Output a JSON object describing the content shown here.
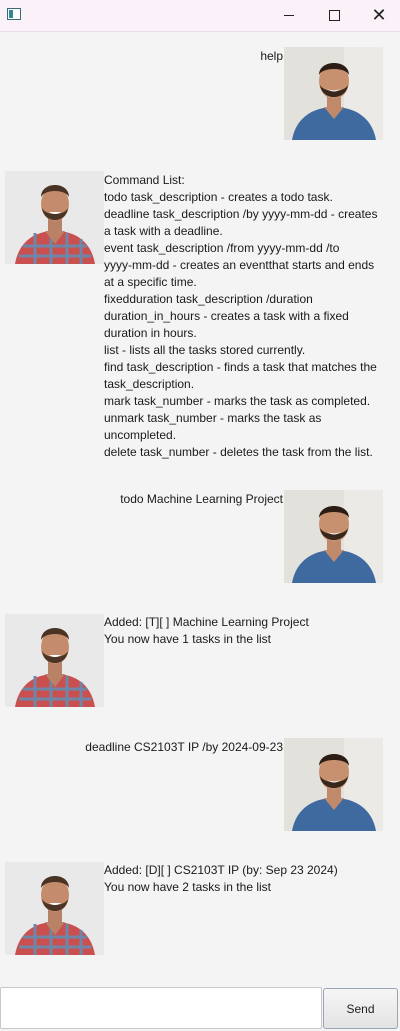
{
  "window": {
    "title": "",
    "minimize": "",
    "maximize": "",
    "close": "✕"
  },
  "chat": {
    "messages": [
      {
        "sender": "user",
        "avatar": "user-avatar",
        "lines": [
          "help"
        ]
      },
      {
        "sender": "bot",
        "avatar": "bot-avatar",
        "lines": [
          "Command List:",
          "todo task_description - creates a todo task.",
          "deadline task_description /by yyyy-mm-dd - creates",
          "a task with a deadline.",
          "event task_description /from yyyy-mm-dd /to",
          "yyyy-mm-dd - creates an eventthat starts and ends",
          "at a specific time.",
          "fixedduration task_description /duration",
          "duration_in_hours - creates a task with a fixed",
          "duration in hours.",
          "list - lists all the tasks stored currently.",
          "find task_description - finds a task that matches the",
          "task_description.",
          "mark task_number - marks the task as completed.",
          "unmark task_number - marks the task as",
          "uncompleted.",
          "delete task_number - deletes the task from the list."
        ]
      },
      {
        "sender": "user",
        "avatar": "user-avatar",
        "lines": [
          "todo Machine Learning Project"
        ]
      },
      {
        "sender": "bot",
        "avatar": "bot-avatar",
        "lines": [
          "Added: [T][ ] Machine Learning Project",
          "You now have 1 tasks in the list"
        ]
      },
      {
        "sender": "user",
        "avatar": "user-avatar",
        "lines": [
          "deadline CS2103T IP /by 2024-09-23"
        ]
      },
      {
        "sender": "bot",
        "avatar": "bot-avatar",
        "lines": [
          "Added: [D][ ] CS2103T IP (by: Sep 23 2024)",
          "You now have 2 tasks in the list"
        ]
      }
    ]
  },
  "input": {
    "value": "",
    "placeholder": "",
    "send_label": "Send"
  },
  "colors": {
    "background": "#f4f4f4",
    "titlebar": "#fbf2f9",
    "user_shirt": "#3f6aa0",
    "bot_shirt_red": "#c9504f",
    "bot_shirt_blue": "#6e86a8"
  }
}
